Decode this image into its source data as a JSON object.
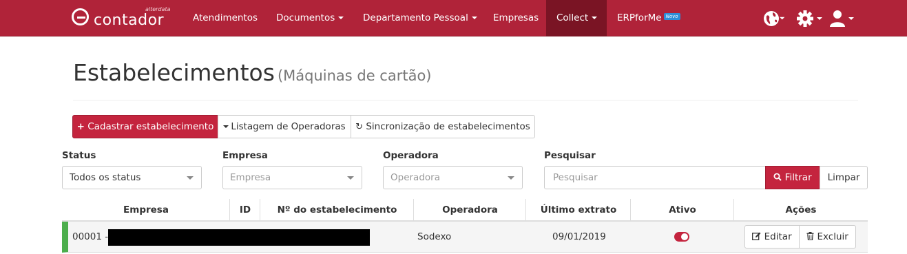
{
  "brand": {
    "small_text": "alterdata",
    "name": "contador"
  },
  "nav": {
    "items": [
      {
        "label": "Atendimentos"
      },
      {
        "label": "Documentos"
      },
      {
        "label": "Departamento Pessoal"
      },
      {
        "label": "Empresas"
      },
      {
        "label": "Collect"
      },
      {
        "label": "ERPforMe"
      }
    ],
    "new_badge": "Novo"
  },
  "header": {
    "title": "Estabelecimentos",
    "subtitle": "(Máquinas de cartão)"
  },
  "toolbar": {
    "add_label": "Cadastrar estabelecimento",
    "operators_label": "Listagem de Operadoras",
    "sync_label": "Sincronização de estabelecimentos"
  },
  "filters": {
    "status": {
      "label": "Status",
      "value": "Todos os status"
    },
    "empresa": {
      "label": "Empresa",
      "placeholder": "Empresa"
    },
    "operadora": {
      "label": "Operadora",
      "placeholder": "Operadora"
    },
    "pesquisar": {
      "label": "Pesquisar",
      "placeholder": "Pesquisar"
    },
    "filter_label": "Filtrar",
    "clear_label": "Limpar"
  },
  "table": {
    "columns": [
      "Empresa",
      "ID",
      "Nº do estabelecimento",
      "Operadora",
      "Último extrato",
      "Ativo",
      "Ações"
    ],
    "rows": [
      {
        "empresa": "00001 -",
        "operadora": "Sodexo",
        "ultimo_extrato": "09/01/2019",
        "ativo": true
      }
    ],
    "edit_label": "Editar",
    "delete_label": "Excluir"
  },
  "colors": {
    "brand": "#b02339",
    "active_nav": "#7a1424",
    "primary": "#c4243e",
    "status_active": "#4cae4c"
  }
}
